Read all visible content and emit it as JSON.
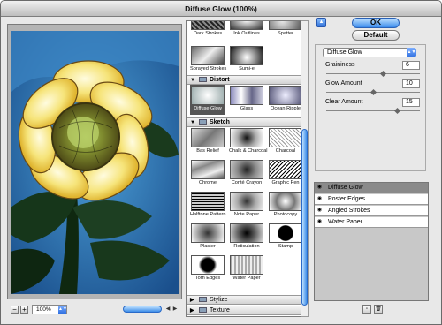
{
  "window": {
    "title": "Diffuse Glow (100%)"
  },
  "preview": {
    "zoom": "100%"
  },
  "gallery": {
    "artistic_row1": [
      {
        "label": "Dark Strokes",
        "icon": "dark-strokes-thumb"
      },
      {
        "label": "Ink Outlines",
        "icon": "ink-outlines-thumb"
      },
      {
        "label": "Spatter",
        "icon": "spatter-thumb"
      }
    ],
    "artistic_row2": [
      {
        "label": "Sprayed Strokes",
        "icon": "sprayed-strokes-thumb"
      },
      {
        "label": "Sumi-e",
        "icon": "sumi-e-thumb"
      }
    ],
    "distort": {
      "label": "Distort",
      "items": [
        {
          "label": "Diffuse Glow",
          "selected": true
        },
        {
          "label": "Glass",
          "selected": false
        },
        {
          "label": "Ocean Ripple",
          "selected": false
        }
      ]
    },
    "sketch": {
      "label": "Sketch",
      "items": [
        {
          "label": "Bas Relief"
        },
        {
          "label": "Chalk & Charcoal"
        },
        {
          "label": "Charcoal"
        },
        {
          "label": "Chrome"
        },
        {
          "label": "Conté Crayon"
        },
        {
          "label": "Graphic Pen"
        },
        {
          "label": "Halftone Pattern"
        },
        {
          "label": "Note Paper"
        },
        {
          "label": "Photocopy"
        },
        {
          "label": "Plaster"
        },
        {
          "label": "Reticulation"
        },
        {
          "label": "Stamp"
        },
        {
          "label": "Torn Edges"
        },
        {
          "label": "Water Paper"
        }
      ]
    },
    "stylize": {
      "label": "Stylize"
    },
    "texture": {
      "label": "Texture"
    }
  },
  "buttons": {
    "ok": "OK",
    "default": "Default"
  },
  "settings": {
    "filter": "Diffuse Glow",
    "params": [
      {
        "label": "Graininess",
        "value": "6",
        "fraction": 0.6
      },
      {
        "label": "Glow Amount",
        "value": "10",
        "fraction": 0.5
      },
      {
        "label": "Clear Amount",
        "value": "15",
        "fraction": 0.75
      }
    ]
  },
  "layers": [
    {
      "name": "Diffuse Glow",
      "active": true
    },
    {
      "name": "Poster Edges",
      "active": false
    },
    {
      "name": "Angled Strokes",
      "active": false
    },
    {
      "name": "Water Paper",
      "active": false
    }
  ],
  "colors": {
    "accent": "#3a8bec",
    "selected_layer": "#8a8a8a"
  }
}
